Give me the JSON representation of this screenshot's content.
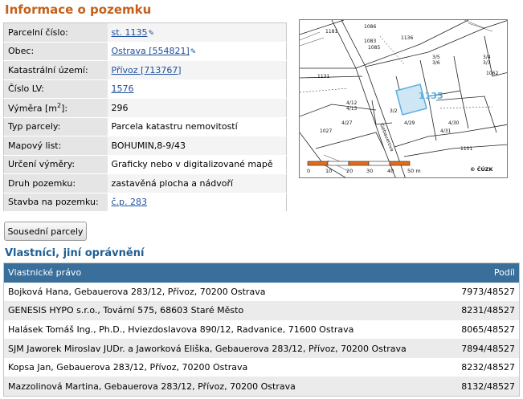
{
  "page": {
    "title": "Informace o pozemku",
    "owners_title": "Vlastníci, jiní oprávnění"
  },
  "parcel": {
    "rows": [
      {
        "label": "Parcelní číslo:",
        "value": "st. 1135",
        "link": true,
        "ext": true
      },
      {
        "label": "Obec:",
        "value": "Ostrava [554821]",
        "link": true,
        "ext": true
      },
      {
        "label": "Katastrální území:",
        "value": "Přívoz [713767]",
        "link": true,
        "ext": false
      },
      {
        "label": "Číslo LV:",
        "value": "1576",
        "link": true,
        "ext": false
      },
      {
        "label": "Výměra [m2]:",
        "value": "296",
        "link": false,
        "ext": false
      },
      {
        "label": "Typ parcely:",
        "value": "Parcela katastru nemovitostí",
        "link": false,
        "ext": false
      },
      {
        "label": "Mapový list:",
        "value": "BOHUMIN,8-9/43",
        "link": false,
        "ext": false
      },
      {
        "label": "Určení výměry:",
        "value": "Graficky nebo v digitalizované mapě",
        "link": false,
        "ext": false
      },
      {
        "label": "Druh pozemku:",
        "value": "zastavěná plocha a nádvoří",
        "link": false,
        "ext": false
      },
      {
        "label": "Stavba na pozemku:",
        "value": "č.p. 283",
        "link": true,
        "ext": false
      }
    ]
  },
  "map": {
    "parcel_label": "1135",
    "scale_labels": [
      "0",
      "10",
      "20",
      "30",
      "40",
      "50 m"
    ],
    "copyright": "© ČÚZK",
    "plot_labels": [
      "1181",
      "1086",
      "1083",
      "1085",
      "1136",
      "1062",
      "3/5",
      "3/6",
      "3/4",
      "3/3",
      "1131",
      "4/12",
      "4/13",
      "4/27",
      "1027",
      "1101",
      "4/29",
      "4/31",
      "4/30",
      "3/2",
      "Gebauerova"
    ]
  },
  "actions": {
    "neighbors_button": "Sousední parcely"
  },
  "owners": {
    "headers": {
      "right": "Vlastnické právo",
      "share": "Podíl"
    },
    "rows": [
      {
        "name": "Bojková Hana, Gebauerova 283/12, Přívoz, 70200 Ostrava",
        "share": "7973/48527"
      },
      {
        "name": "GENESIS HYPO s.r.o., Tovární 575, 68603 Staré Město",
        "share": "8231/48527"
      },
      {
        "name": "Halásek Tomáš Ing., Ph.D., Hviezdoslavova 890/12, Radvanice, 71600 Ostrava",
        "share": "8065/48527"
      },
      {
        "name": "SJM Jaworek Miroslav JUDr. a Jaworková Eliška, Gebauerova 283/12, Přívoz, 70200 Ostrava",
        "share": "7894/48527"
      },
      {
        "name": "Kopsa Jan, Gebauerova 283/12, Přívoz, 70200 Ostrava",
        "share": "8232/48527"
      },
      {
        "name": "Mazzolinová Martina, Gebauerova 283/12, Přívoz, 70200 Ostrava",
        "share": "8132/48527"
      }
    ]
  },
  "colors": {
    "title": "#c4601a",
    "subtitle": "#1f5e93",
    "header_bg": "#3a6f9c",
    "link": "#1e4f9c",
    "parcel_highlight": "#5aaee0",
    "scale_orange": "#e36c1c"
  }
}
